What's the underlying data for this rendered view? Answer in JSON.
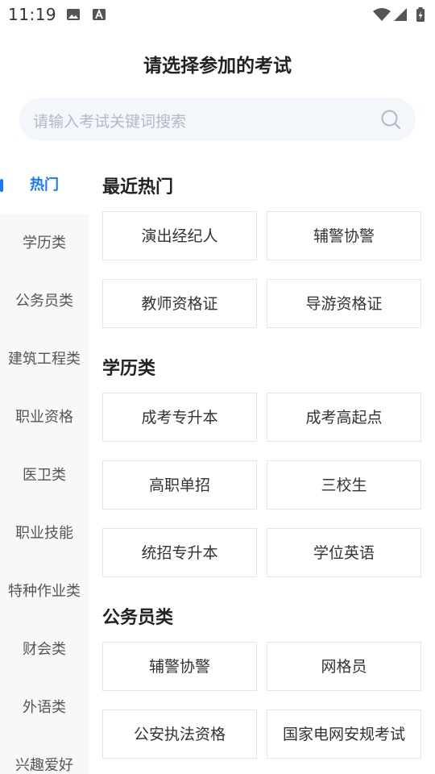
{
  "status_bar": {
    "time": "11:19",
    "icons": [
      "image-icon",
      "a-letter-icon",
      "wifi-icon",
      "signal-icon",
      "battery-charging-icon"
    ]
  },
  "header": {
    "title": "请选择参加的考试"
  },
  "search": {
    "placeholder": "请输入考试关键词搜索",
    "icon": "search-icon"
  },
  "colors": {
    "accent": "#1677ff",
    "sidebar_bg": "#f7f8fa",
    "search_bg": "#f3f6fb"
  },
  "sidebar": {
    "active_index": 0,
    "items": [
      {
        "label": "热门"
      },
      {
        "label": "学历类"
      },
      {
        "label": "公务员类"
      },
      {
        "label": "建筑工程类"
      },
      {
        "label": "职业资格"
      },
      {
        "label": "医卫类"
      },
      {
        "label": "职业技能"
      },
      {
        "label": "特种作业类"
      },
      {
        "label": "财会类"
      },
      {
        "label": "外语类"
      },
      {
        "label": "兴趣爱好"
      }
    ]
  },
  "sections": [
    {
      "title": "最近热门",
      "items": [
        "演出经纪人",
        "辅警协警",
        "教师资格证",
        "导游资格证"
      ]
    },
    {
      "title": "学历类",
      "items": [
        "成考专升本",
        "成考高起点",
        "高职单招",
        "三校生",
        "统招专升本",
        "学位英语"
      ]
    },
    {
      "title": "公务员类",
      "items": [
        "辅警协警",
        "网格员",
        "公安执法资格",
        "国家电网安规考试"
      ]
    }
  ]
}
